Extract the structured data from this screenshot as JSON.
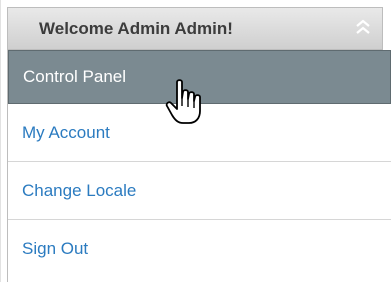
{
  "header": {
    "title": "Welcome Admin Admin!",
    "collapse_icon": "double-chevron-up-icon"
  },
  "menu": {
    "items": [
      {
        "label": "Control Panel",
        "state": "hover"
      },
      {
        "label": "My Account"
      },
      {
        "label": "Change Locale"
      },
      {
        "label": "Sign Out"
      }
    ]
  },
  "pointer": {
    "icon": "hand-pointer-icon"
  },
  "colors": {
    "link": "#2b7bc0",
    "hover_bg": "#7b8a91",
    "header_text": "#3c3c3c"
  }
}
